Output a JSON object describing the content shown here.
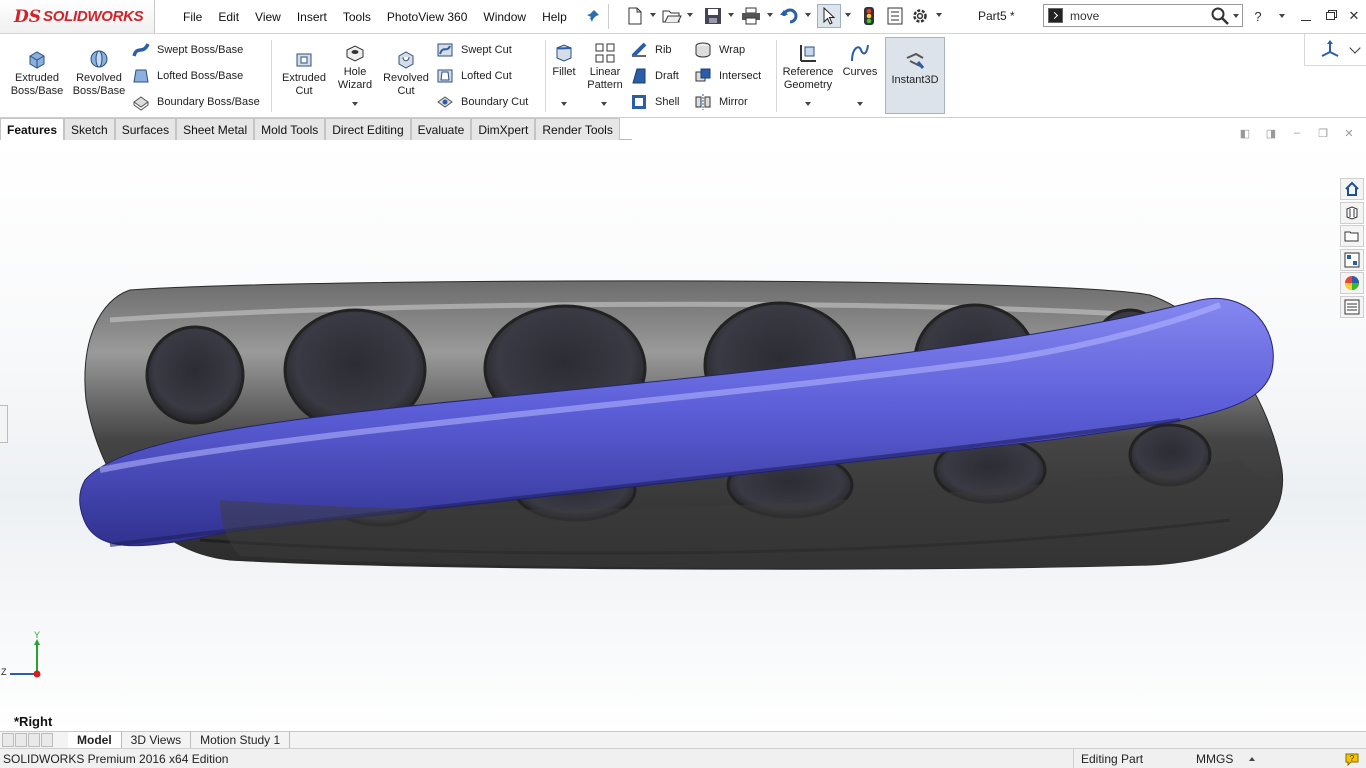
{
  "app": {
    "logo_prefix": "DS",
    "logo_text": "SOLIDWORKS",
    "document_name": "Part5 *"
  },
  "menu": [
    "File",
    "Edit",
    "View",
    "Insert",
    "Tools",
    "PhotoView 360",
    "Window",
    "Help"
  ],
  "search": {
    "value": "move"
  },
  "ribbon": {
    "extruded_boss": [
      "Extruded",
      "Boss/Base"
    ],
    "revolved_boss": [
      "Revolved",
      "Boss/Base"
    ],
    "swept_boss": "Swept Boss/Base",
    "lofted_boss": "Lofted Boss/Base",
    "boundary_boss": "Boundary Boss/Base",
    "extruded_cut": [
      "Extruded",
      "Cut"
    ],
    "hole_wizard": [
      "Hole",
      "Wizard"
    ],
    "revolved_cut": [
      "Revolved",
      "Cut"
    ],
    "swept_cut": "Swept Cut",
    "lofted_cut": "Lofted Cut",
    "boundary_cut": "Boundary Cut",
    "fillet": "Fillet",
    "linear_pattern": [
      "Linear",
      "Pattern"
    ],
    "rib": "Rib",
    "draft": "Draft",
    "shell": "Shell",
    "wrap": "Wrap",
    "intersect": "Intersect",
    "mirror": "Mirror",
    "reference_geometry": [
      "Reference",
      "Geometry"
    ],
    "curves": "Curves",
    "instant3d": "Instant3D"
  },
  "command_tabs": [
    "Features",
    "Sketch",
    "Surfaces",
    "Sheet Metal",
    "Mold Tools",
    "Direct Editing",
    "Evaluate",
    "DimXpert",
    "Render Tools"
  ],
  "active_command_tab": "Features",
  "viewport": {
    "view_label": "*Right",
    "triad_y": "Y",
    "triad_z": "Z"
  },
  "bottom_tabs": [
    "Model",
    "3D Views",
    "Motion Study 1"
  ],
  "status": {
    "product": "SOLIDWORKS Premium 2016 x64 Edition",
    "mode": "Editing Part",
    "units": "MMGS"
  },
  "colors": {
    "brand_red": "#d2232a",
    "body_blue": "#5a5cd6",
    "body_gray": "#4a4a4a"
  }
}
